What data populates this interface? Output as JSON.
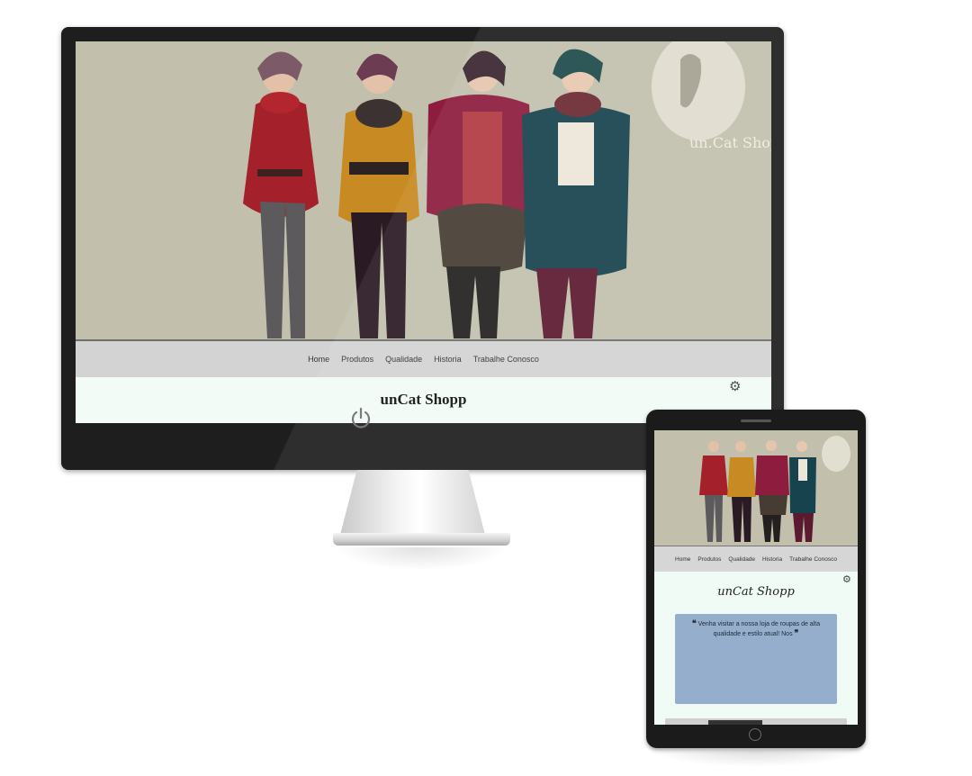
{
  "desktop": {
    "nav_items": [
      "Home",
      "Produtos",
      "Qualidade",
      "Historia",
      "Trabalhe Conosco"
    ],
    "brand": "unCat Shopp",
    "hero_logo_text": "un.Cat Shopp"
  },
  "tablet": {
    "nav_items": [
      "Home",
      "Produtos",
      "Qualidade",
      "Historia",
      "Trabalhe Conosco"
    ],
    "brand": "unCat Shopp",
    "quote": "Venha visitar a nossa loja de roupas de alta qualidade e estilo atual! Nos"
  },
  "colors": {
    "hero_bg": "#c2c0ac",
    "nav_bg": "#d3d3d3",
    "page_bg": "#f2fbf6",
    "quote_card": "#94aecb",
    "bezel": "#1e1e1e"
  },
  "icons": [
    "gear-icon",
    "power-icon",
    "home-button-icon",
    "quote-open-icon",
    "quote-close-icon"
  ]
}
